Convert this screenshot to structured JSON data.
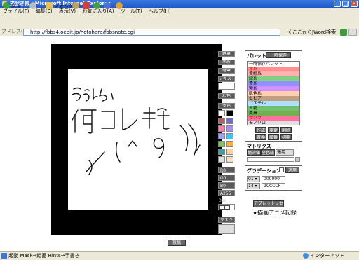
{
  "window": {
    "title": "描我き帳 - Microsoft Internet Explorer"
  },
  "menu": [
    "ファイル(F)",
    "編集(E)",
    "表示(V)",
    "お気に入り(A)",
    "ツール(T)",
    "ヘルプ(H)"
  ],
  "toolbar": {
    "back": "戻る",
    "folder": "フォルダ"
  },
  "address": {
    "label": "アドレス(D)",
    "url": "http://fbbs4.oebit.jp/hotohara/fbbsnote.cgi",
    "links": "くここからJWord検索",
    "go_icon": "go-icon"
  },
  "tools": [
    "鉢筆",
    "水彩",
    "班筆",
    "テキスト",
    "彩色",
    "多色"
  ],
  "swatch_colors": [
    "#ffffff",
    "#000000",
    "#b06060",
    "#7070c0",
    "#ff7fb0",
    "#a090ff",
    "#a0a0ff",
    "#40c0ff",
    "#80c060",
    "#ffb030",
    "#40a0a0",
    "#ffd0a0",
    "#e0e0e0",
    "#f0e0c0"
  ],
  "rgb_labels": [
    "R0",
    "G0",
    "B0",
    "A255"
  ],
  "size_label": "3px",
  "mask_label": "マスク",
  "palette": {
    "title": "パレット",
    "temp_save": "一時保存",
    "items": [
      {
        "label": "一時保存パレット",
        "bg": "#ffffff",
        "fg": "#000000"
      },
      {
        "label": "赤系",
        "bg": "#ff9090",
        "fg": "#cc0000"
      },
      {
        "label": "黄緑系",
        "bg": "#ffb0b0",
        "fg": "#000000"
      },
      {
        "label": "緑系",
        "bg": "#80d080",
        "fg": "#000000"
      },
      {
        "label": "青系",
        "bg": "#9090ff",
        "fg": "#000000"
      },
      {
        "label": "紫系",
        "bg": "#d090ff",
        "fg": "#000000"
      },
      {
        "label": "肌色系",
        "bg": "#ffd0b0",
        "fg": "#000000"
      },
      {
        "label": "セピア",
        "bg": "#c0a080",
        "fg": "#000000"
      },
      {
        "label": "パステル",
        "bg": "#b0e0ff",
        "fg": "#000000"
      },
      {
        "label": "人物",
        "bg": "#70c070",
        "fg": "#000000"
      },
      {
        "label": "風景",
        "bg": "#70b050",
        "fg": "#000000"
      },
      {
        "label": "サクラ",
        "bg": "#ff70a0",
        "fg": "#cc0000"
      },
      {
        "label": "モノクロ",
        "bg": "#e0e0e0",
        "fg": "#000000"
      }
    ],
    "buttons": [
      "作成",
      "変更",
      "削除",
      "置換",
      "順番",
      "初期"
    ]
  },
  "matrix": {
    "title": "マトリクス",
    "mode": "絶対値",
    "selection": "全色端",
    "action": "適用"
  },
  "gradation": {
    "title": "グラデーション",
    "apply": "適用",
    "rows": [
      {
        "num": "01",
        "color": "000000"
      },
      {
        "num": "14",
        "color": "9CCCCF"
      }
    ]
  },
  "applet_button": "アプレットリセット",
  "anime_link": "★描画アニメ記録",
  "bottom_button": "投稿",
  "statusbar": {
    "left": "起動 Mask→絵画 Hints→手書き",
    "right": "インターネット"
  }
}
